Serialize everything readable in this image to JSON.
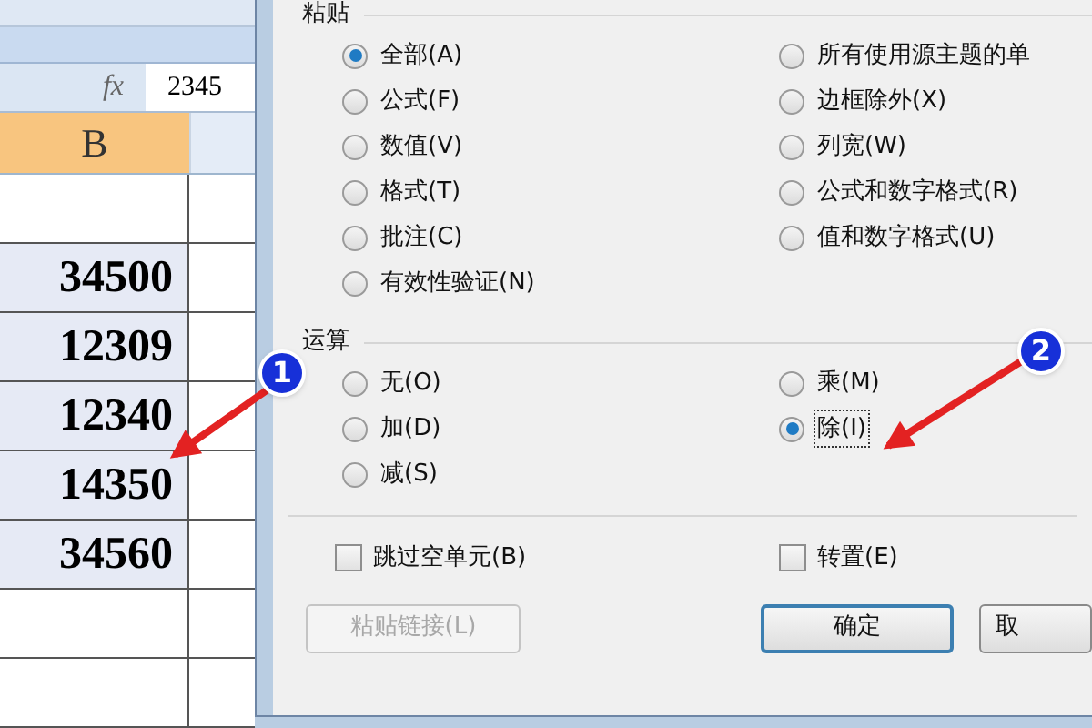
{
  "spreadsheet": {
    "formula_bar": {
      "fx": "fx",
      "value": "2345"
    },
    "column_header": {
      "label": "B",
      "selected": true
    },
    "rows": [
      {
        "selected": false
      },
      {
        "value": "34500",
        "selected": true
      },
      {
        "value": "12309",
        "selected": true
      },
      {
        "value": "12340",
        "selected": true
      },
      {
        "value": "14350",
        "selected": true
      },
      {
        "value": "34560",
        "selected": true
      },
      {
        "selected": false
      },
      {
        "selected": false
      }
    ]
  },
  "dialog": {
    "paste": {
      "title": "粘贴",
      "left_options": [
        {
          "label": "全部(A)",
          "selected": true
        },
        {
          "label": "公式(F)",
          "selected": false
        },
        {
          "label": "数值(V)",
          "selected": false
        },
        {
          "label": "格式(T)",
          "selected": false
        },
        {
          "label": "批注(C)",
          "selected": false
        },
        {
          "label": "有效性验证(N)",
          "selected": false
        }
      ],
      "right_options": [
        {
          "label": "所有使用源主题的单",
          "selected": false
        },
        {
          "label": "边框除外(X)",
          "selected": false
        },
        {
          "label": "列宽(W)",
          "selected": false
        },
        {
          "label": "公式和数字格式(R)",
          "selected": false
        },
        {
          "label": "值和数字格式(U)",
          "selected": false
        }
      ]
    },
    "operation": {
      "title": "运算",
      "left_options": [
        {
          "label": "无(O)",
          "selected": false
        },
        {
          "label": "加(D)",
          "selected": false
        },
        {
          "label": "减(S)",
          "selected": false
        }
      ],
      "right_options": [
        {
          "label": "乘(M)",
          "selected": false
        },
        {
          "label": "除(I)",
          "selected": true
        }
      ]
    },
    "checkboxes": [
      {
        "label": "跳过空单元(B)",
        "checked": false
      },
      {
        "label": "转置(E)",
        "checked": false
      }
    ],
    "buttons": [
      {
        "label": "粘贴链接(L)",
        "disabled": true,
        "default": false
      },
      {
        "label": "确定",
        "disabled": false,
        "default": true
      },
      {
        "label": "取",
        "disabled": false,
        "default": false
      }
    ]
  },
  "annotations": [
    {
      "label": "1"
    },
    {
      "label": "2"
    }
  ]
}
